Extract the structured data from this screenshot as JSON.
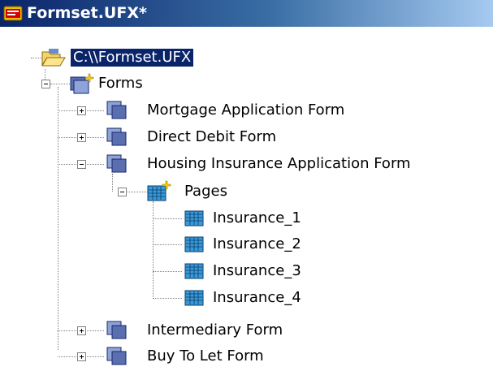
{
  "window": {
    "title": "Formset.UFX*"
  },
  "tree": {
    "root": {
      "label": "C:\\\\Formset.UFX"
    },
    "forms_node": {
      "label": "Forms"
    },
    "forms": [
      {
        "label": "Mortgage Application Form",
        "expanded": false
      },
      {
        "label": "Direct Debit Form",
        "expanded": false
      },
      {
        "label": "Housing Insurance Application Form",
        "expanded": true
      },
      {
        "label": "Intermediary Form",
        "expanded": false
      },
      {
        "label": "Buy To Let Form",
        "expanded": false
      }
    ],
    "pages_node": {
      "label": "Pages"
    },
    "pages": [
      {
        "label": "Insurance_1"
      },
      {
        "label": "Insurance_2"
      },
      {
        "label": "Insurance_3"
      },
      {
        "label": "Insurance_4"
      }
    ]
  }
}
